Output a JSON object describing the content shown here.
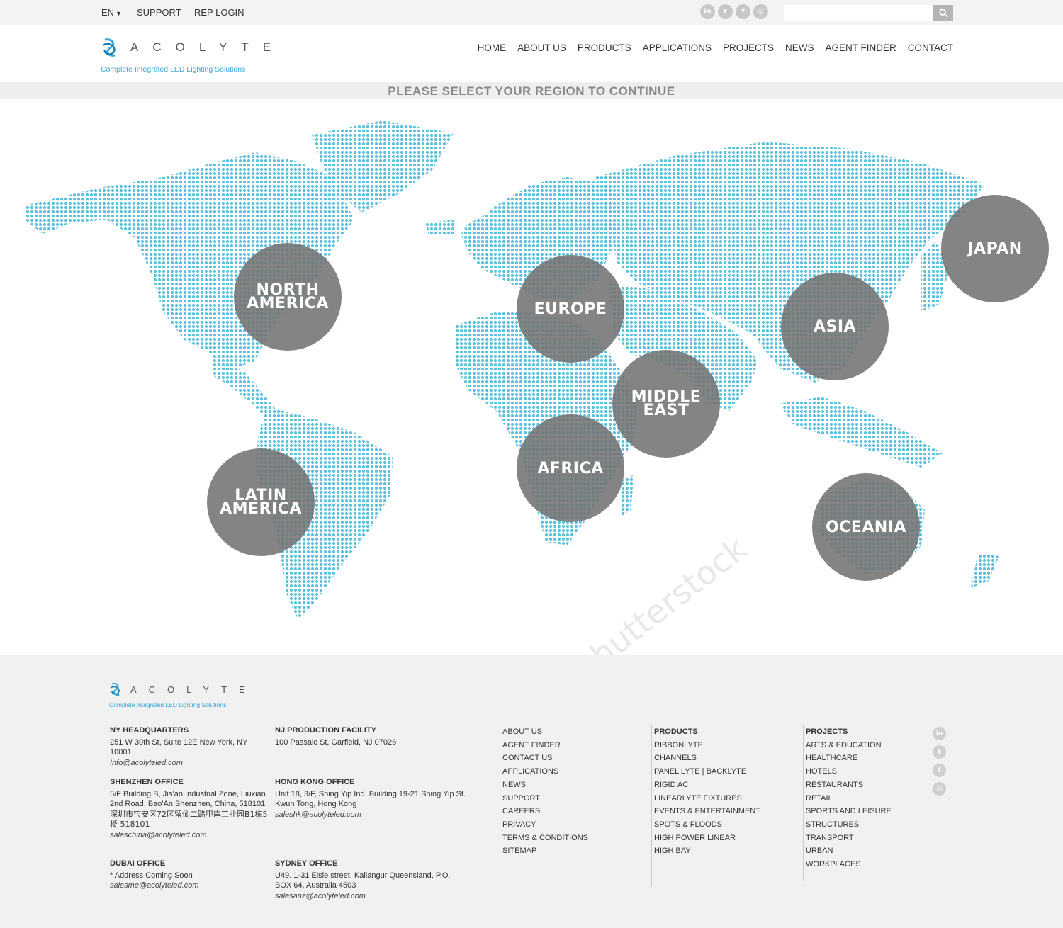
{
  "topbar": {
    "language": "EN",
    "links": [
      "SUPPORT",
      "REP LOGIN"
    ],
    "social": [
      {
        "name": "linkedin-icon",
        "glyph": "in"
      },
      {
        "name": "twitter-icon",
        "glyph": "t"
      },
      {
        "name": "facebook-icon",
        "glyph": "f"
      },
      {
        "name": "instagram-icon",
        "glyph": "◎"
      }
    ],
    "search_placeholder": ""
  },
  "header": {
    "logo_word": "ACOLYTE",
    "tagline": "Complete Integrated LED Lighting Solutions",
    "nav": [
      "HOME",
      "ABOUT US",
      "PRODUCTS",
      "APPLICATIONS",
      "PROJECTS",
      "NEWS",
      "AGENT FINDER",
      "CONTACT"
    ]
  },
  "region_title": "PLEASE SELECT YOUR REGION TO CONTINUE",
  "regions": [
    {
      "id": "north-america",
      "label": "NORTH\nAMERICA"
    },
    {
      "id": "europe",
      "label": "EUROPE"
    },
    {
      "id": "asia",
      "label": "ASIA"
    },
    {
      "id": "japan",
      "label": "JAPAN"
    },
    {
      "id": "middle-east",
      "label": "MIDDLE\nEAST"
    },
    {
      "id": "africa",
      "label": "AFRICA"
    },
    {
      "id": "latin-america",
      "label": "LATIN\nAMERICA"
    },
    {
      "id": "oceania",
      "label": "OCEANIA"
    }
  ],
  "watermark": "shutterstock",
  "colors": {
    "accent": "#3aa9d8",
    "map_dots": "#5cc1de",
    "region_circle": "#737373"
  },
  "footer": {
    "offices": [
      {
        "title": "NY HEADQUARTERS",
        "lines": [
          "251 W 30th St, Suite 12E New York, NY 10001"
        ],
        "email": "Info@acolyteled.com"
      },
      {
        "title": "NJ PRODUCTION FACILITY",
        "lines": [
          "100 Passaic St, Garfield, NJ 07026"
        ],
        "email": ""
      },
      {
        "title": "SHENZHEN OFFICE",
        "lines": [
          "5/F Building B, Jia'an Industrial Zone, Liuxian 2nd Road, Bao'An Shenzhen, China, 518101",
          "深圳市宝安区72区留仙二路甲岸工业园B1栋5楼 518101"
        ],
        "email": "saleschina@acolyteled.com"
      },
      {
        "title": "HONG KONG OFFICE",
        "lines": [
          "Unit 18, 3/F, Shing Yip Ind. Building 19-21 Shing Yip St. Kwun Tong, Hong Kong"
        ],
        "email": "saleshk@acolyteled.com"
      },
      {
        "title": "DUBAI OFFICE",
        "lines": [
          "* Address Coming Soon"
        ],
        "email": "salesme@acolyteled.com"
      },
      {
        "title": "SYDNEY OFFICE",
        "lines": [
          "U49. 1-31 Elsie street, Kallangur Queensland, P.O. BOX 64, Australia 4503"
        ],
        "email": "salesanz@acolyteled.com"
      }
    ],
    "links_col1": [
      "ABOUT US",
      "AGENT FINDER",
      "CONTACT US",
      "APPLICATIONS",
      "NEWS",
      "SUPPORT",
      "CAREERS",
      "PRIVACY",
      "TERMS & CONDITIONS",
      "SITEMAP"
    ],
    "products_title": "PRODUCTS",
    "products": [
      "RIBBONLYTE",
      "CHANNELS",
      "PANEL LYTE | BACKLYTE",
      "RIGID AC",
      "LINEARLYTE FIXTURES",
      "EVENTS & ENTERTAINMENT",
      "SPOTS & FLOODS",
      "HIGH POWER LINEAR",
      "HIGH BAY"
    ],
    "projects_title": "PROJECTS",
    "projects": [
      "ARTS & EDUCATION",
      "HEALTHCARE",
      "HOTELS",
      "RESTAURANTS",
      "RETAIL",
      "SPORTS AND LEISURE",
      "STRUCTURES",
      "TRANSPORT",
      "URBAN",
      "WORKPLACES"
    ]
  }
}
